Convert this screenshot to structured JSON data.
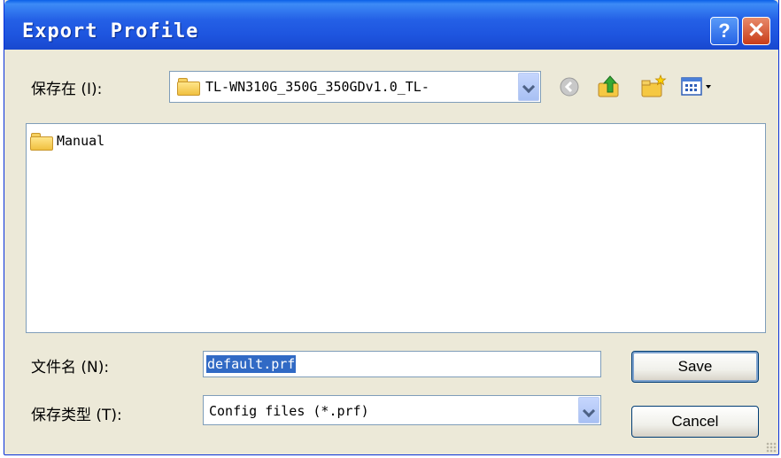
{
  "window": {
    "title": "Export Profile",
    "help_label": "?",
    "close_label": "✕"
  },
  "save_in": {
    "label": "保存在 (I):",
    "value": "TL-WN310G_350G_350GDv1.0_TL-",
    "icon": "folder-icon"
  },
  "toolbar": {
    "icons": [
      "back-icon",
      "up-folder-icon",
      "new-folder-icon",
      "view-menu-icon"
    ]
  },
  "file_list": {
    "items": [
      {
        "name": "Manual",
        "icon": "folder-icon"
      }
    ]
  },
  "file_name": {
    "label": "文件名 (N):",
    "value": "default.prf"
  },
  "file_type": {
    "label": "保存类型 (T):",
    "value": "Config files (*.prf)"
  },
  "buttons": {
    "save": "Save",
    "cancel": "Cancel"
  },
  "colors": {
    "titlebar": "#1E55DF",
    "dialog_bg": "#ECE9D8",
    "selection": "#316AC5"
  }
}
